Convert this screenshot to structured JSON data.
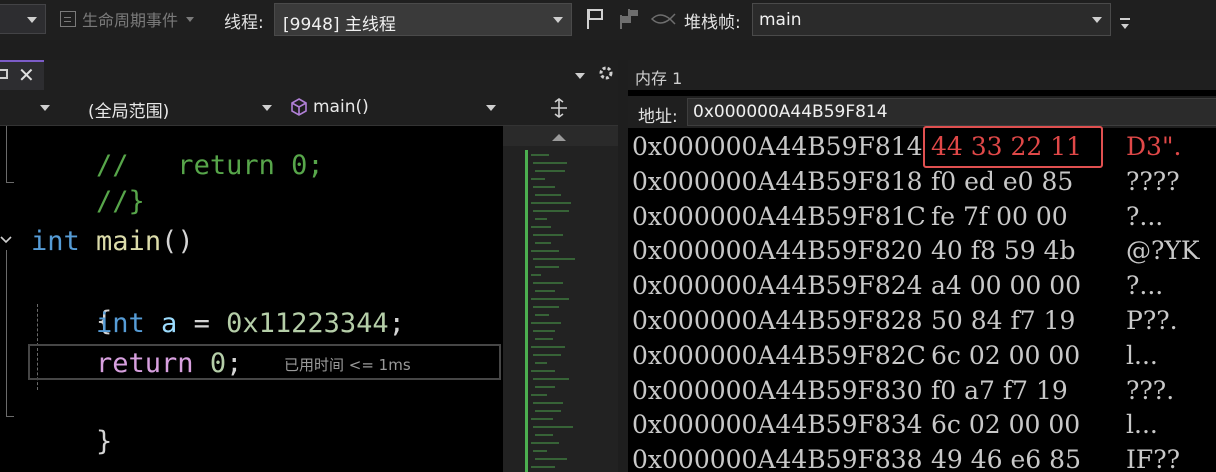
{
  "toolbar": {
    "lifecycle_events": "生命周期事件",
    "thread_label": "线程:",
    "thread_value": "[9948] 主线程",
    "stack_frame_label": "堆栈帧:",
    "stack_frame_value": "main",
    "icons": [
      "flag-icon",
      "flag-group-icon",
      "fish-icon",
      "overflow-icon"
    ]
  },
  "editor": {
    "tab_close": "✕",
    "scope_value": "(全局范围)",
    "function_value": "main()",
    "code": {
      "line_partial": "//   return 0;",
      "line_close_comment": "//}",
      "main_kw": "int",
      "main_fn": "main",
      "main_paren": "()",
      "open_brace": "{",
      "decl_kw": "int",
      "decl_var": "a",
      "decl_op": " = ",
      "decl_num": "0x11223344",
      "decl_end": ";",
      "ret_kw": "return",
      "ret_num": "0",
      "ret_end": ";",
      "close_brace": "}"
    },
    "perf_tip": "已用时间 <= 1ms"
  },
  "memory": {
    "title": "内存 1",
    "address_label": "地址:",
    "address_value": "0x000000A44B59F814",
    "rows": [
      {
        "addr": "0x000000A44B59F814",
        "bytes": "44 33 22 11",
        "chars": "D3\".",
        "changed": true
      },
      {
        "addr": "0x000000A44B59F818",
        "bytes": "f0 ed e0 85",
        "chars": "????"
      },
      {
        "addr": "0x000000A44B59F81C",
        "bytes": "fe 7f 00 00",
        "chars": "?..."
      },
      {
        "addr": "0x000000A44B59F820",
        "bytes": "40 f8 59 4b",
        "chars": "@?YK"
      },
      {
        "addr": "0x000000A44B59F824",
        "bytes": "a4 00 00 00",
        "chars": "?..."
      },
      {
        "addr": "0x000000A44B59F828",
        "bytes": "50 84 f7 19",
        "chars": "P??."
      },
      {
        "addr": "0x000000A44B59F82C",
        "bytes": "6c 02 00 00",
        "chars": "l..."
      },
      {
        "addr": "0x000000A44B59F830",
        "bytes": "f0 a7 f7 19",
        "chars": "???."
      },
      {
        "addr": "0x000000A44B59F834",
        "bytes": "6c 02 00 00",
        "chars": "l..."
      },
      {
        "addr": "0x000000A44B59F838",
        "bytes": "49 46 e6 85",
        "chars": "IF??"
      }
    ]
  },
  "colors": {
    "keyword": "#569cd6",
    "function": "#dcdcaa",
    "variable": "#9cdcfe",
    "number": "#b5cea8",
    "control": "#d8a0df",
    "changed_bytes": "#e04848",
    "minimap_change_bar": "#4caf50"
  }
}
